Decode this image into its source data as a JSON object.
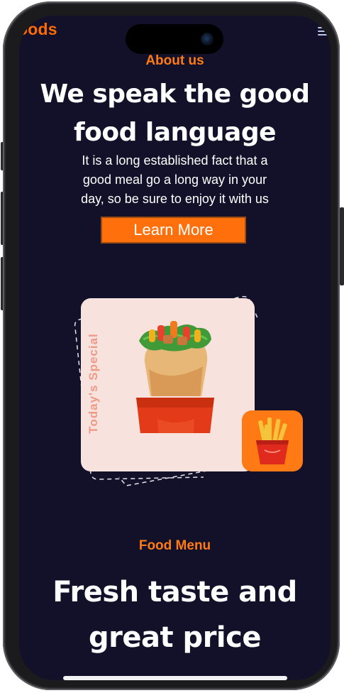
{
  "nav": {
    "brand": "oods",
    "menu_icon": "hamburger-icon"
  },
  "about": {
    "eyebrow": "About us",
    "title_line1": "We speak the good",
    "title_line2": "food language",
    "text_line1": "It is a long established fact that a",
    "text_line2": "good meal go a long way in your",
    "text_line3": "day, so be sure to enjoy it with us",
    "button_label": "Learn More"
  },
  "special": {
    "label": "Today's Special",
    "main_image": "wrap-sandwich-illustration",
    "side_image": "french-fries-illustration"
  },
  "food_menu": {
    "eyebrow": "Food Menu",
    "title_line1": "Fresh taste and",
    "title_line2": "great price"
  },
  "colors": {
    "accent": "#ff6b00",
    "background": "#13112a",
    "card": "#f8e2dd",
    "special_label": "#ef9a87"
  }
}
